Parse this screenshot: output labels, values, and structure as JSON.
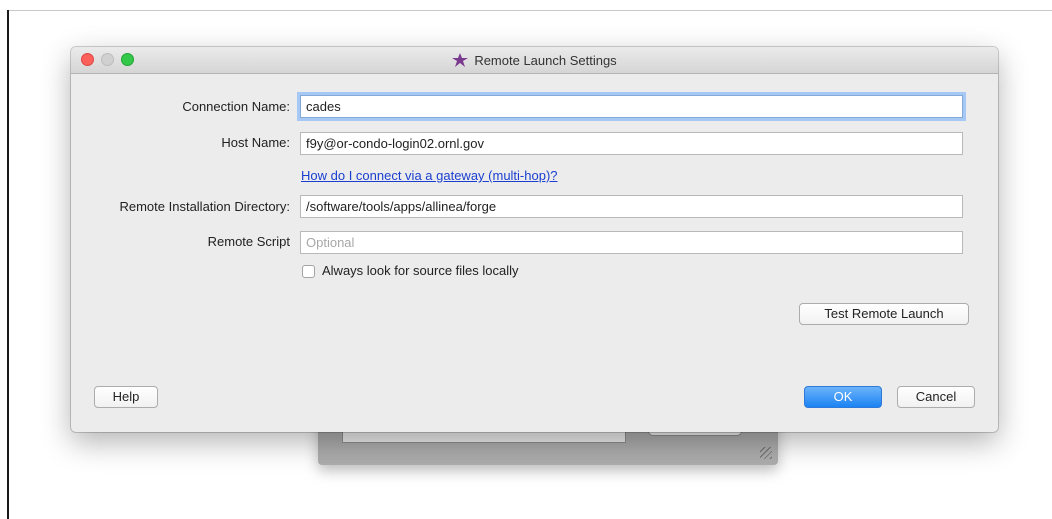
{
  "window": {
    "title": "Remote Launch Settings",
    "app_icon": "forge-star-icon"
  },
  "form": {
    "connection_name": {
      "label": "Connection Name:",
      "value": "cades"
    },
    "host_name": {
      "label": "Host Name:",
      "value": "f9y@or-condo-login02.ornl.gov"
    },
    "gateway_link": "How do I connect via a gateway (multi-hop)?",
    "remote_install_dir": {
      "label": "Remote Installation Directory:",
      "value": "/software/tools/apps/allinea/forge"
    },
    "remote_script": {
      "label": "Remote Script",
      "value": "",
      "placeholder": "Optional"
    },
    "always_local_sources": {
      "label": "Always look for source files locally",
      "checked": false
    }
  },
  "buttons": {
    "test_remote_launch": "Test Remote Launch",
    "help": "Help",
    "ok": "OK",
    "cancel": "Cancel"
  },
  "colors": {
    "accent": "#1b83f3",
    "link": "#1a3fd0",
    "close": "#fc605b",
    "zoom": "#34c84a"
  }
}
